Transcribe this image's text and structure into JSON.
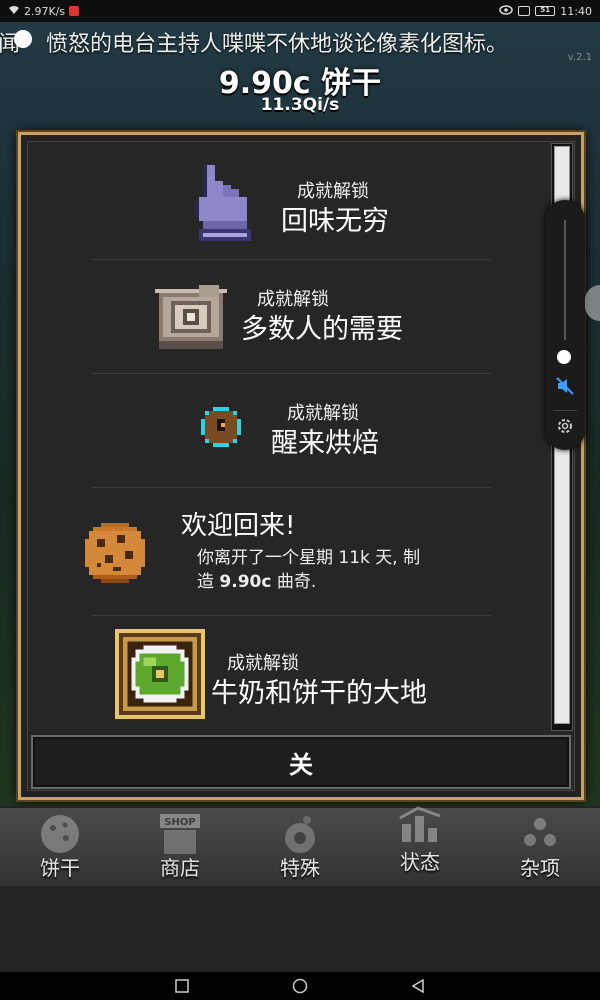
{
  "status_bar": {
    "speed": "2.97K/s",
    "time": "11:40",
    "battery": "51"
  },
  "ticker": {
    "prefix": "闻",
    "text": "愤怒的电台主持人喋喋不休地谈论像素化图标。"
  },
  "header": {
    "cookie_count": "9.90c 饼干",
    "cps": "11.3Qi/s",
    "version": "v.2.1"
  },
  "dialog": {
    "entries": [
      {
        "small": "成就解锁",
        "big": "回味无穷",
        "icon": "pixel-hand-icon"
      },
      {
        "small": "成就解锁",
        "big": "多数人的需要",
        "icon": "pixel-fractal-icon"
      },
      {
        "small": "成就解锁",
        "big": "醒来烘焙",
        "icon": "pixel-orb-icon"
      },
      {
        "title": "欢迎回来!",
        "line1": "你离开了一个星期 11k 天, 制",
        "line2_pre": "造 ",
        "line2_bold": "9.90c",
        "line2_post": " 曲奇.",
        "icon": "cookie-icon"
      },
      {
        "small": "成就解锁",
        "big": "牛奶和饼干的大地",
        "icon": "milk-planet-icon"
      }
    ],
    "close_label": "关"
  },
  "tabs": [
    {
      "label": "饼干",
      "icon": "cookie-tab-icon"
    },
    {
      "label": "商店",
      "icon": "shop-tab-icon",
      "sign": "SHOP"
    },
    {
      "label": "特殊",
      "icon": "special-tab-icon"
    },
    {
      "label": "状态",
      "icon": "stats-tab-icon"
    },
    {
      "label": "杂项",
      "icon": "misc-tab-icon"
    }
  ],
  "colors": {
    "dialog_border": "#c7a36a",
    "mute_icon": "#3aa0ff"
  }
}
